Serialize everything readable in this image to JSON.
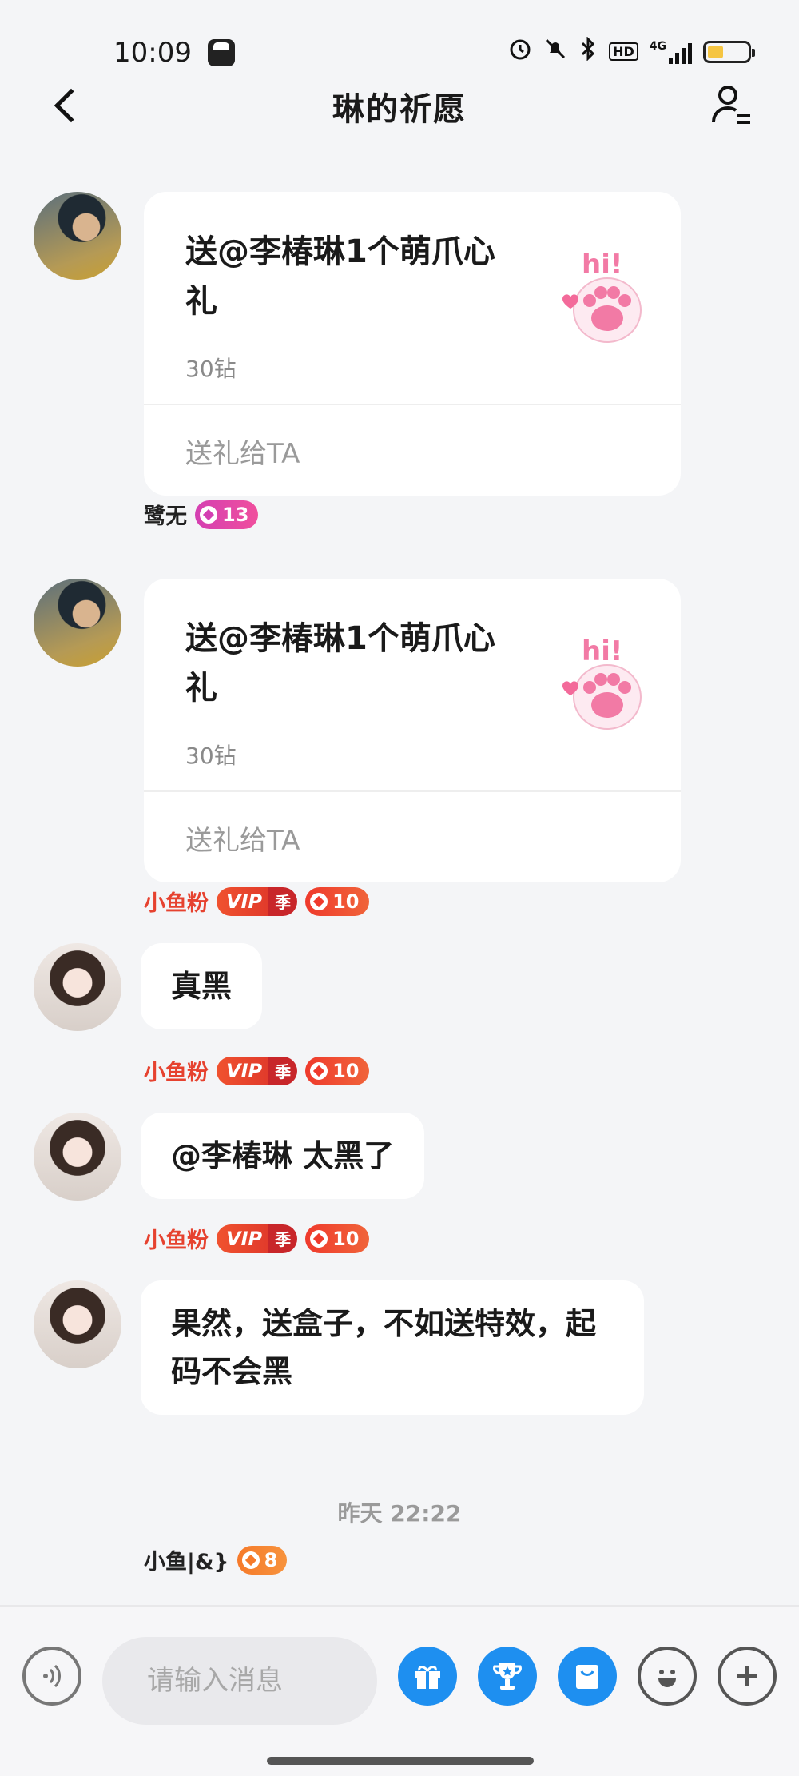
{
  "status_bar": {
    "time": "10:09",
    "icons": [
      "app-icon",
      "alarm-icon",
      "mute-icon",
      "bluetooth-icon",
      "hd-icon",
      "signal-4g-icon",
      "battery-icon"
    ],
    "hd_label": "HD",
    "network_label": "4G",
    "battery_level": 0.4
  },
  "header": {
    "title": "琳的祈愿"
  },
  "messages": [
    {
      "sender": "鹭无",
      "level": "13",
      "gift_text": "送@李椿琳1个萌爪心礼",
      "price": "30钻",
      "action": "送礼给TA"
    },
    {
      "sender": "鹭无",
      "level": "13",
      "gift_text": "送@李椿琳1个萌爪心礼",
      "price": "30钻",
      "action": "送礼给TA"
    },
    {
      "sender": "小鱼粉",
      "vip": "VIP",
      "season": "季",
      "level": "10",
      "text": "真黑"
    },
    {
      "sender": "小鱼粉",
      "vip": "VIP",
      "season": "季",
      "level": "10",
      "text": "@李椿琳 太黑了"
    },
    {
      "sender": "小鱼粉",
      "vip": "VIP",
      "season": "季",
      "level": "10",
      "text": "果然，送盒子，不如送特效，起码不会黑"
    }
  ],
  "timestamp": "昨天 22:22",
  "last_sender": {
    "sender": "小鱼|&}",
    "level": "8"
  },
  "input": {
    "placeholder": "请输入消息"
  },
  "colors": {
    "accent_blue": "#1e8ff0",
    "vip_red": "#e6422f",
    "badge_pink": "#d43fb2"
  }
}
